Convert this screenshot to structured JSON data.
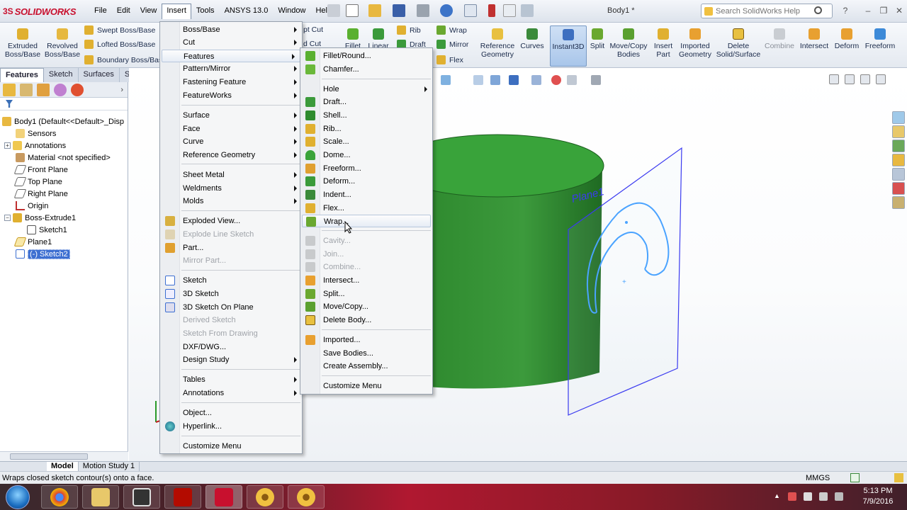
{
  "app": {
    "logo_prefix": "3S",
    "logo_text": "SOLIDWORKS",
    "menu": [
      "File",
      "Edit",
      "View",
      "Insert",
      "Tools",
      "ANSYS 13.0",
      "Window",
      "Help"
    ],
    "document_title": "Body1 *",
    "search_placeholder": "Search SolidWorks Help"
  },
  "commands": {
    "extruded": "Extruded Boss/Base",
    "revolved": "Revolved Boss/Base",
    "swept": "Swept Boss/Base",
    "lofted": "Lofted Boss/Base",
    "boundary": "Boundary Boss/Base",
    "swept_cut": "pt Cut",
    "lofted_cut": "d Cut",
    "fillet": "Fillet",
    "linear": "Linear",
    "rib": "Rib",
    "draft": "Draft",
    "wrap": "Wrap",
    "mirror": "Mirror",
    "flex": "Flex",
    "reference_geometry": "Reference Geometry",
    "curves": "Curves",
    "instant3d": "Instant3D",
    "split": "Split",
    "move_copy": "Move/Copy Bodies",
    "insert_part": "Insert Part",
    "imported_geometry": "Imported Geometry",
    "delete_solid": "Delete Solid/Surface",
    "combine": "Combine",
    "intersect": "Intersect",
    "deform": "Deform",
    "freeform": "Freeform"
  },
  "tabs": [
    "Features",
    "Sketch",
    "Surfaces",
    "Sheet M"
  ],
  "tree": {
    "root": "Body1  (Default<<Default>_Disp",
    "items": [
      "Sensors",
      "Annotations",
      "Material <not specified>",
      "Front Plane",
      "Top Plane",
      "Right Plane",
      "Origin",
      "Boss-Extrude1",
      "Sketch1",
      "Plane1",
      "(-) Sketch2"
    ]
  },
  "insert_menu": {
    "items": [
      "Boss/Base",
      "Cut",
      "Features",
      "Pattern/Mirror",
      "Fastening Feature",
      "FeatureWorks",
      "Surface",
      "Face",
      "Curve",
      "Reference Geometry",
      "Sheet Metal",
      "Weldments",
      "Molds",
      "Exploded View...",
      "Explode Line Sketch",
      "Part...",
      "Mirror Part...",
      "Sketch",
      "3D Sketch",
      "3D Sketch On Plane",
      "Derived Sketch",
      "Sketch From Drawing",
      "DXF/DWG...",
      "Design Study",
      "Tables",
      "Annotations",
      "Object...",
      "Hyperlink...",
      "Customize Menu"
    ]
  },
  "features_menu": {
    "items": [
      "Fillet/Round...",
      "Chamfer...",
      "Hole",
      "Draft...",
      "Shell...",
      "Rib...",
      "Scale...",
      "Dome...",
      "Freeform...",
      "Deform...",
      "Indent...",
      "Flex...",
      "Wrap...",
      "Cavity...",
      "Join...",
      "Combine...",
      "Intersect...",
      "Split...",
      "Move/Copy...",
      "Delete Body...",
      "Imported...",
      "Save Bodies...",
      "Create Assembly...",
      "Customize Menu"
    ]
  },
  "viewport": {
    "plane_label": "Plane1",
    "cylinder_color": "#2e8b2e",
    "sketch_color": "#4aa3ff"
  },
  "bottom_tabs": [
    "Model",
    "Motion Study 1"
  ],
  "status": {
    "text": "Wraps closed sketch contour(s) onto a face.",
    "units": "MMGS"
  },
  "taskbar": {
    "time": "5:13 PM",
    "date": "7/9/2016"
  }
}
